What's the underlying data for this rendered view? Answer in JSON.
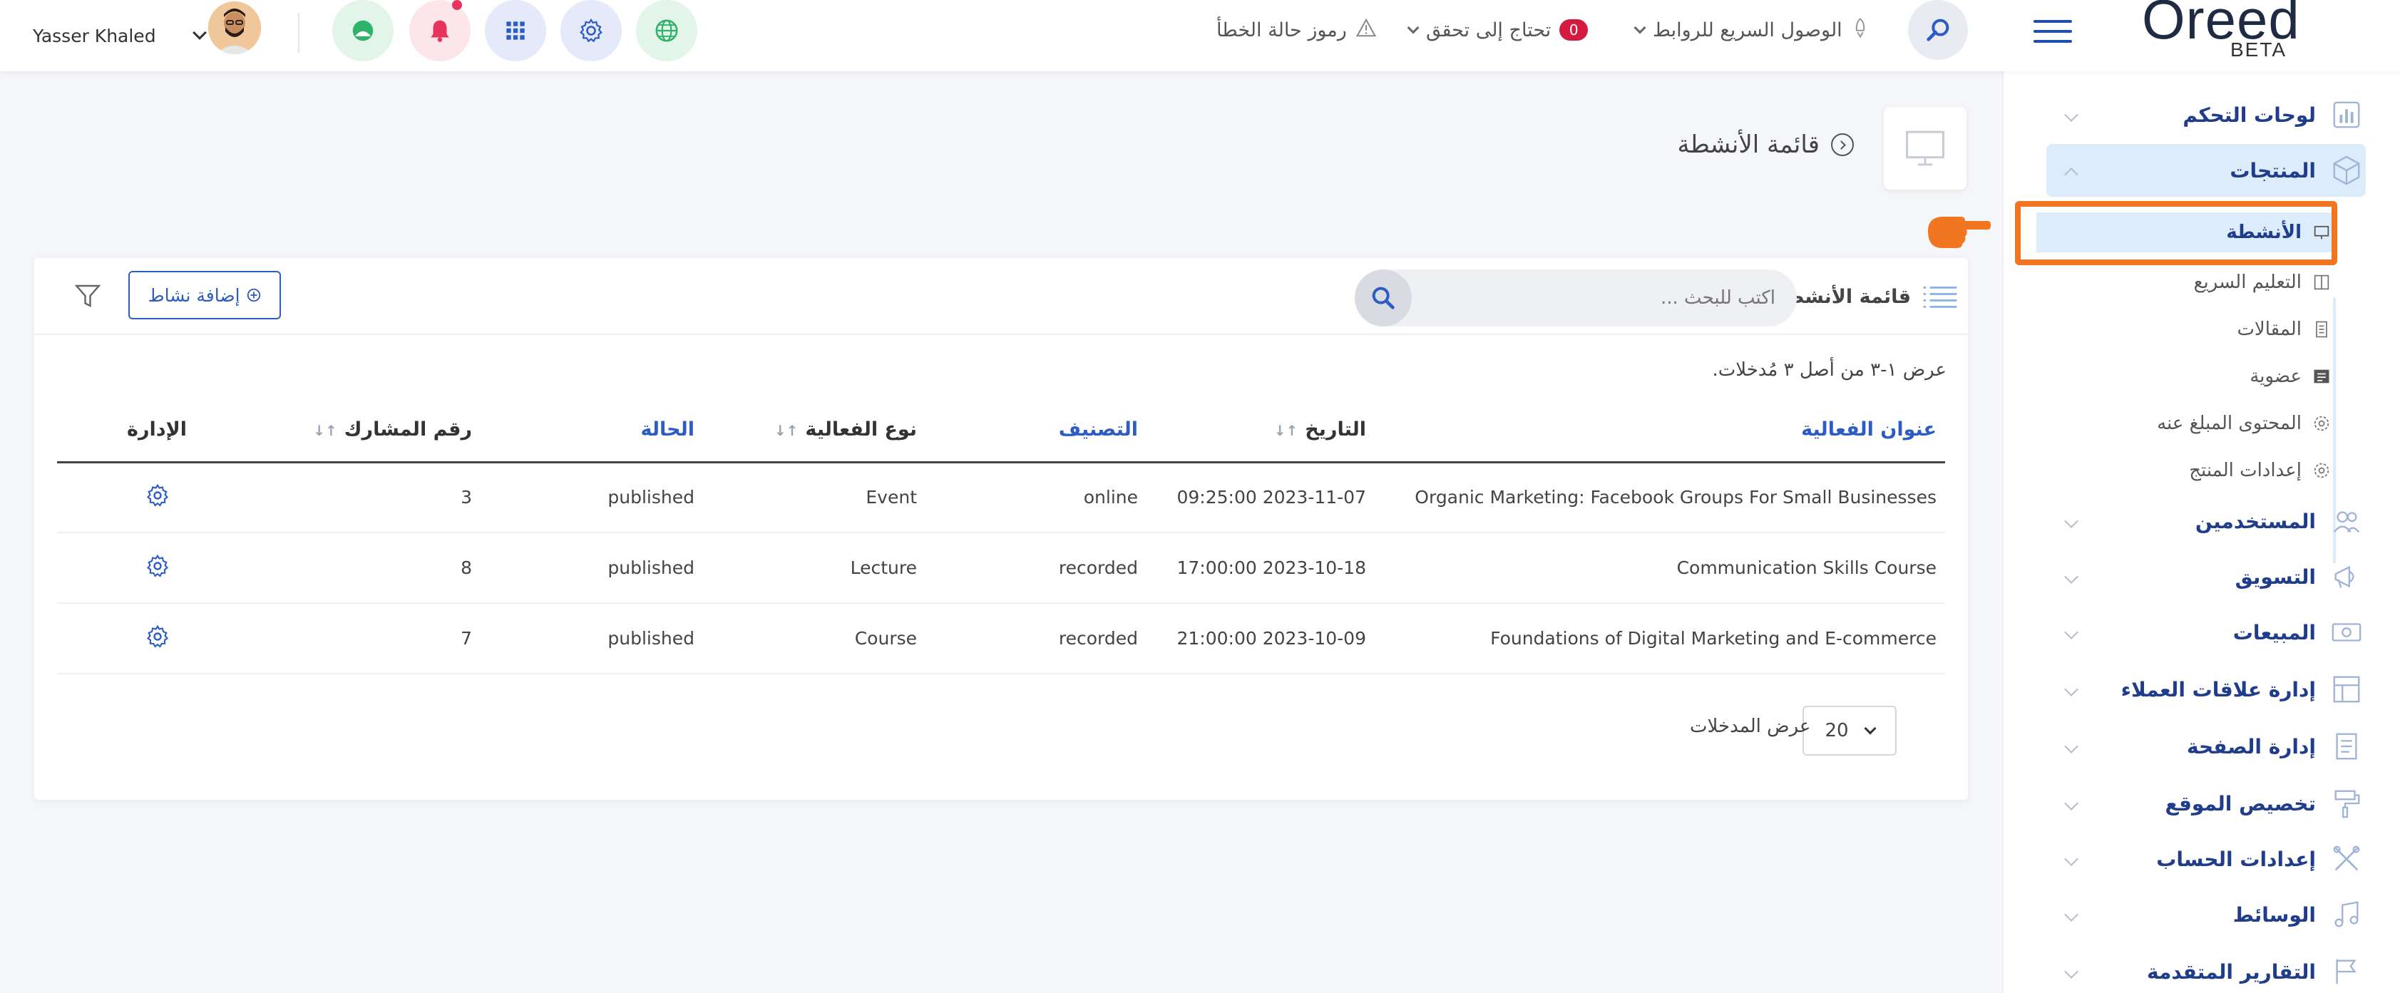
{
  "colors": {
    "accent": "#2e5cc5",
    "sidebar_active": "#dcecfb",
    "highlight": "#f27522",
    "badge": "#d5193f"
  },
  "header": {
    "user_name": "Yasser Khaled",
    "error_codes": "رموز حالة الخطأ",
    "needs_check": "تحتاج إلى تحقق",
    "needs_check_count": "0",
    "quick_links": "الوصول السريع للروابط",
    "logo": "Oreed",
    "logo_badge": "BETA",
    "icons": [
      "globe-icon",
      "gear-icon",
      "grid-icon",
      "bell-icon",
      "location-icon"
    ]
  },
  "sidebar": {
    "items": [
      {
        "label": "لوحات التحكم",
        "icon": "chart-icon"
      },
      {
        "label": "المنتجات",
        "icon": "cube-icon"
      },
      {
        "label": "المستخدمين",
        "icon": "users-icon"
      },
      {
        "label": "التسويق",
        "icon": "megaphone-icon"
      },
      {
        "label": "المبيعات",
        "icon": "money-icon"
      },
      {
        "label": "إدارة علاقات العملاء",
        "icon": "crm-icon"
      },
      {
        "label": "إدارة الصفحة",
        "icon": "page-icon"
      },
      {
        "label": "تخصيص الموقع",
        "icon": "paint-roller-icon"
      },
      {
        "label": "إعدادات الحساب",
        "icon": "tools-icon"
      },
      {
        "label": "الوسائط",
        "icon": "music-icon"
      },
      {
        "label": "التقارير المتقدمة",
        "icon": "flag-icon"
      }
    ],
    "sub_items": [
      {
        "label": "الأنشطة",
        "icon": "monitor-icon"
      },
      {
        "label": "التعليم السريع",
        "icon": "book-icon"
      },
      {
        "label": "المقالات",
        "icon": "article-icon"
      },
      {
        "label": "عضوية",
        "icon": "id-card-icon"
      },
      {
        "label": "المحتوى المبلغ عنه",
        "icon": "gear-icon"
      },
      {
        "label": "إعدادات المنتج",
        "icon": "gear-icon"
      }
    ]
  },
  "page": {
    "title": "قائمة الأنشطة"
  },
  "list": {
    "title": "قائمة الأنشطة",
    "search_placeholder": "اكتب للبحث ...",
    "add_button": "إضافة نشاط",
    "showing": "عرض ١-٣ من أصل ٣ مُدخلات.",
    "columns": [
      "عنوان الفعالية",
      "التاريخ",
      "التصنيف",
      "نوع الفعالية",
      "الحالة",
      "رقم المشارك",
      "الإدارة"
    ],
    "rows": [
      {
        "title": "Organic Marketing: Facebook Groups For Small Businesses",
        "date": "2023-11-07 09:25:00",
        "category": "online",
        "type": "Event",
        "status": "published",
        "participants": "3"
      },
      {
        "title": "Communication Skills Course",
        "date": "2023-10-18 17:00:00",
        "category": "recorded",
        "type": "Lecture",
        "status": "published",
        "participants": "8"
      },
      {
        "title": "Foundations of Digital Marketing and E-commerce",
        "date": "2023-10-09 21:00:00",
        "category": "recorded",
        "type": "Course",
        "status": "published",
        "participants": "7"
      }
    ],
    "per_page": "20",
    "per_page_label": "عرض المدخلات"
  }
}
